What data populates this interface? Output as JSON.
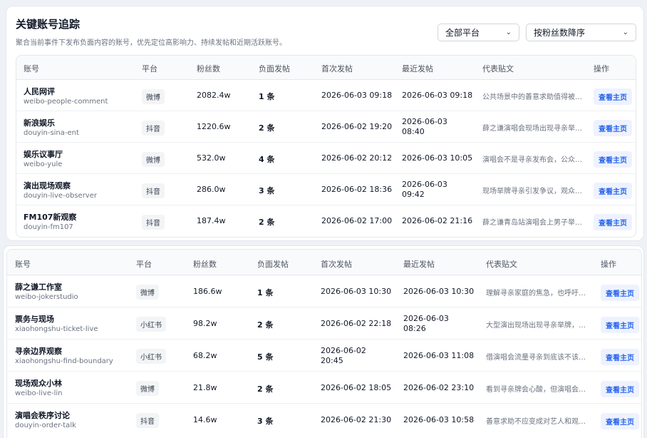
{
  "header": {
    "title": "关键账号追踪",
    "subtitle": "聚合当前事件下发布负面内容的账号，优先定位高影响力、持续发帖和近期活跃账号。"
  },
  "filters": {
    "platform": "全部平台",
    "sort": "按粉丝数降序"
  },
  "columns": {
    "account": "账号",
    "platform": "平台",
    "fans": "粉丝数",
    "negative": "负面发帖",
    "first": "首次发帖",
    "latest": "最近发帖",
    "sample": "代表贴文",
    "action": "操作"
  },
  "table_top": {
    "rows": [
      {
        "name": "人民网评",
        "handle": "weibo-people-comment",
        "platform": "微博",
        "fans": "2082.4w",
        "negative": "1 条",
        "first": "2026-06-03 09:18",
        "latest": "2026-06-03 09:18",
        "sample": "公共场景中的善意求助值得被…",
        "action": "查看主页"
      },
      {
        "name": "新浪娱乐",
        "handle": "douyin-sina-ent",
        "platform": "抖音",
        "fans": "1220.6w",
        "negative": "2 条",
        "first": "2026-06-02 19:20",
        "latest_a": "2026-06-03",
        "latest_b": "08:40",
        "sample": "薛之谦演唱会现场出现寻亲举…",
        "action": "查看主页"
      },
      {
        "name": "娱乐议事厅",
        "handle": "weibo-yule",
        "platform": "微博",
        "fans": "532.0w",
        "negative": "4 条",
        "first": "2026-06-02 20:12",
        "latest": "2026-06-03 10:05",
        "sample": "演唱会不是寻亲发布会，公众…",
        "action": "查看主页"
      },
      {
        "name": "演出现场观察",
        "handle": "douyin-live-observer",
        "platform": "抖音",
        "fans": "286.0w",
        "negative": "3 条",
        "first": "2026-06-02 18:36",
        "latest_a": "2026-06-03",
        "latest_b": "09:42",
        "sample": "现场举牌寻亲引发争议，观众…",
        "action": "查看主页"
      },
      {
        "name": "FM107新观察",
        "handle": "douyin-fm107",
        "platform": "抖音",
        "fans": "187.4w",
        "negative": "2 条",
        "first": "2026-06-02 17:00",
        "latest": "2026-06-02 21:16",
        "sample": "薛之谦青岛站演唱会上男子举…",
        "action": "查看主页"
      }
    ]
  },
  "table_bottom": {
    "rows": [
      {
        "name": "薛之谦工作室",
        "handle": "weibo-jokerstudio",
        "platform": "微博",
        "fans": "186.6w",
        "negative": "1 条",
        "first": "2026-06-03 10:30",
        "latest": "2026-06-03 10:30",
        "sample": "理解寻亲家庭的焦急，也呼吁…",
        "action": "查看主页"
      },
      {
        "name": "票务与现场",
        "handle": "xiaohongshu-ticket-live",
        "platform": "小红书",
        "fans": "98.2w",
        "negative": "2 条",
        "first": "2026-06-02 22:18",
        "latest_a": "2026-06-03",
        "latest_b": "08:26",
        "sample": "大型演出现场出现寻亲举牌，…",
        "action": "查看主页"
      },
      {
        "name": "寻亲边界观察",
        "handle": "xiaohongshu-find-boundary",
        "platform": "小红书",
        "fans": "68.2w",
        "negative": "5 条",
        "first_a": "2026-06-02",
        "first_b": "20:45",
        "latest": "2026-06-03 11:08",
        "sample": "借演唱会流量寻亲到底该不该…",
        "action": "查看主页"
      },
      {
        "name": "现场观众小林",
        "handle": "weibo-live-lin",
        "platform": "微博",
        "fans": "21.8w",
        "negative": "2 条",
        "first": "2026-06-02 18:05",
        "latest": "2026-06-02 23:10",
        "sample": "看到寻亲牌会心酸，但演唱会…",
        "action": "查看主页"
      },
      {
        "name": "演唱会秩序讨论",
        "handle": "douyin-order-talk",
        "platform": "抖音",
        "fans": "14.6w",
        "negative": "3 条",
        "first": "2026-06-02 21:30",
        "latest": "2026-06-03 10:58",
        "sample": "善意求助不应变成对艺人和观…",
        "action": "查看主页"
      }
    ]
  },
  "colors": {
    "accent": "#2563eb",
    "badge_bg": "#f3f4f6",
    "header_bg": "#f9fafb"
  },
  "icons": {
    "select_chevron": "chevron-down-icon"
  }
}
